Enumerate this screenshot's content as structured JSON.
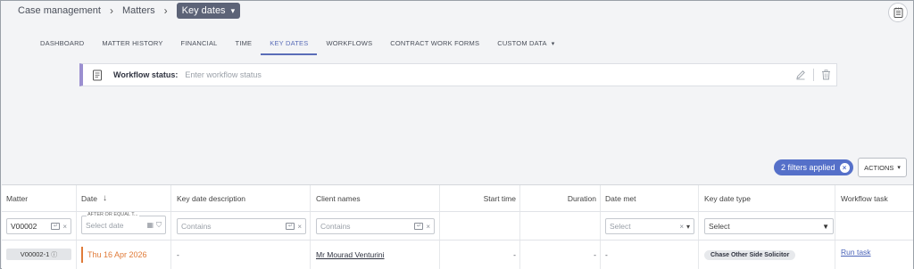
{
  "breadcrumb": {
    "items": [
      "Case management",
      "Matters"
    ],
    "current": "Key dates"
  },
  "tabs": [
    {
      "label": "DASHBOARD",
      "active": false
    },
    {
      "label": "MATTER HISTORY",
      "active": false
    },
    {
      "label": "FINANCIAL",
      "active": false
    },
    {
      "label": "TIME",
      "active": false
    },
    {
      "label": "KEY DATES",
      "active": true
    },
    {
      "label": "WORKFLOWS",
      "active": false
    },
    {
      "label": "CONTRACT WORK FORMS",
      "active": false
    },
    {
      "label": "CUSTOM DATA",
      "active": false
    }
  ],
  "workflow": {
    "label": "Workflow status:",
    "placeholder": "Enter workflow status"
  },
  "filters": {
    "applied_label": "2 filters applied"
  },
  "actions": {
    "label": "ACTIONS"
  },
  "grid": {
    "headers": {
      "matter": "Matter",
      "date": "Date",
      "description": "Key date description",
      "client": "Client names",
      "start_time": "Start time",
      "duration": "Duration",
      "date_met": "Date met",
      "type": "Key date type",
      "task": "Workflow task"
    },
    "filter_row": {
      "matter_value": "V00002",
      "date_legend": "AFTER OR EQUAL T...",
      "date_placeholder": "Select date",
      "description_placeholder": "Contains",
      "client_placeholder": "Contains",
      "date_met_placeholder": "Select",
      "type_placeholder": "Select"
    },
    "rows": [
      {
        "matter": "V00002-1",
        "date": "Thu 16 Apr 2026",
        "description": "-",
        "client": "Mr Mourad Venturini",
        "start_time": "-",
        "duration": "-",
        "date_met": "-",
        "type": "Chase Other Side Solicitor",
        "task": "Run task"
      }
    ]
  },
  "colors": {
    "accent": "#5a6db8",
    "pill": "#5570c9",
    "date_highlight": "#e07b39",
    "workflow_border": "#9b8fd0"
  }
}
